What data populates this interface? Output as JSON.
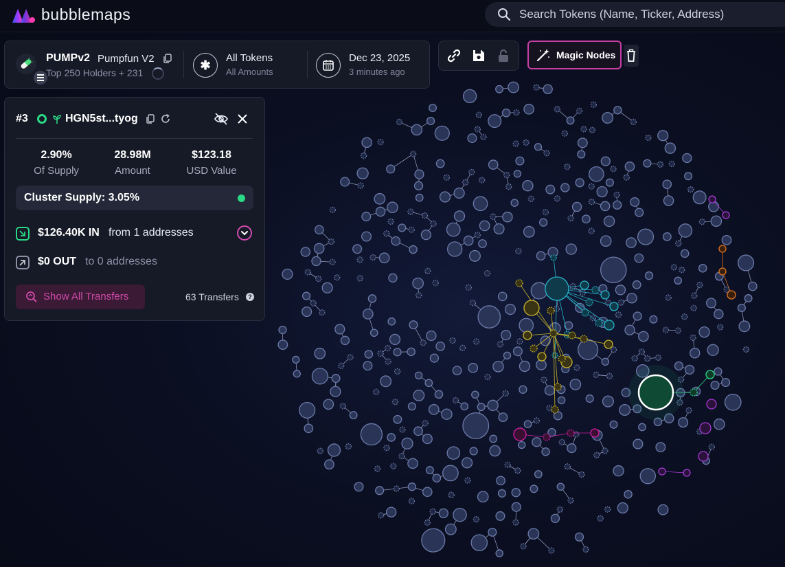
{
  "app": {
    "name": "bubblemaps",
    "search_placeholder": "Search Tokens (Name, Ticker, Address)"
  },
  "token": {
    "symbol": "PUMPv2",
    "name": "Pumpfun V2",
    "holders_text": "Top 250 Holders + 231",
    "filter_title": "All Tokens",
    "filter_sub": "All Amounts",
    "date_title": "Dec 23, 2025",
    "date_sub": "3 minutes ago"
  },
  "toolbar": {
    "magic_label": "Magic Nodes",
    "icons": [
      "link-icon",
      "save-icon",
      "lock-icon",
      "magic-wand-icon",
      "trash-icon"
    ]
  },
  "panel": {
    "rank": "#3",
    "address": "HGN5st...tyog",
    "stats": [
      {
        "value": "2.90%",
        "label": "Of Supply"
      },
      {
        "value": "28.98M",
        "label": "Amount"
      },
      {
        "value": "$123.18",
        "label": "USD Value"
      }
    ],
    "cluster_label": "Cluster Supply: 3.05%",
    "in_amount": "$126.40K IN",
    "in_text": "from 1 addresses",
    "out_amount": "$0 OUT",
    "out_text": "to 0 addresses",
    "show_transfers": "Show All Transfers",
    "transfers_count": "63 Transfers"
  },
  "colors": {
    "accent": "#c640a6",
    "cluster_green": "#2ad985",
    "node_default": "#2a3457",
    "cyan": "#27b3c9",
    "yellow": "#c9b42a",
    "magenta": "#d11fa3",
    "purple": "#a63ad6",
    "orange": "#e0741f",
    "selected_green": "#0f4a35"
  }
}
